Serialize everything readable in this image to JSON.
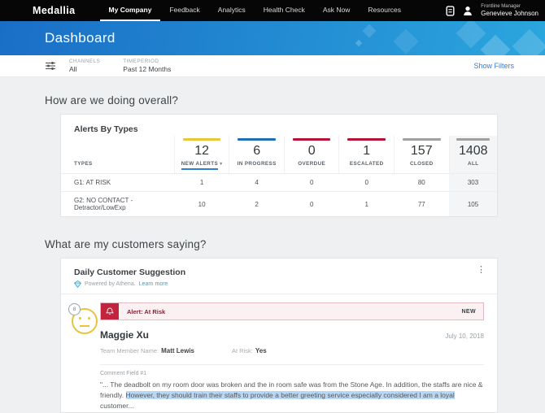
{
  "nav": {
    "brand": "Medallia",
    "items": [
      {
        "label": "My Company",
        "active": true
      },
      {
        "label": "Feedback",
        "active": false
      },
      {
        "label": "Analytics",
        "active": false
      },
      {
        "label": "Health Check",
        "active": false
      },
      {
        "label": "Ask Now",
        "active": false
      },
      {
        "label": "Resources",
        "active": false
      }
    ],
    "user_role": "Frontline Manager",
    "user_name": "Genevieve Johnson"
  },
  "header": {
    "title": "Dashboard"
  },
  "filter_bar": {
    "channels_label": "CHANNELS",
    "channels_value": "All",
    "timeperiod_label": "TIMEPERIOD",
    "timeperiod_value": "Past 12 Months",
    "show_filters_label": "Show Filters"
  },
  "overall_section": {
    "heading": "How are we doing overall?",
    "card_title": "Alerts By Types",
    "types_header": "TYPES",
    "stats": [
      {
        "label": "NEW ALERTS",
        "value": "12",
        "color": "#e9c63a",
        "sorted": true
      },
      {
        "label": "IN PROGRESS",
        "value": "6",
        "color": "#1e6fb4",
        "sorted": false
      },
      {
        "label": "OVERDUE",
        "value": "0",
        "color": "#b81238",
        "sorted": false
      },
      {
        "label": "ESCALATED",
        "value": "1",
        "color": "#b81238",
        "sorted": false
      },
      {
        "label": "CLOSED",
        "value": "157",
        "color": "#a0a0a0",
        "sorted": false
      },
      {
        "label": "ALL",
        "value": "1408",
        "color": "#a0a0a0",
        "sorted": false
      }
    ],
    "rows": [
      {
        "type": "G1: AT RISK",
        "values": [
          "1",
          "4",
          "0",
          "0",
          "80",
          "303"
        ]
      },
      {
        "type": "G2: NO CONTACT - Detractor/LowExp",
        "values": [
          "10",
          "2",
          "0",
          "1",
          "77",
          "105"
        ]
      }
    ]
  },
  "customers_section": {
    "heading": "What are my customers saying?",
    "card_title": "Daily Customer Suggestion",
    "powered_by": "Powered by Athena.",
    "learn_more": "Learn more",
    "score": "8",
    "alert_label": "Alert: At Risk",
    "new_badge": "NEW",
    "customer_name": "Maggie Xu",
    "date": "July 10, 2018",
    "team_member_label": "Team Member Name:",
    "team_member_value": "Matt Lewis",
    "at_risk_label": "At Risk:",
    "at_risk_value": "Yes",
    "comment_label": "Comment Field #1",
    "comment_pre": "\"... The deadbolt on my room door was broken and the in room safe was from the Stone Age.  In addition, the staffs are nice & friendly. ",
    "comment_highlight": "However, they should train their staffs to provide a better greeting service especially considered I am a loyal ",
    "comment_post": "customer..."
  },
  "icons": {
    "kebab": "⋮",
    "sort_caret": "▾",
    "names": [
      "document-icon",
      "user-icon",
      "filter-sliders-icon",
      "bell-icon",
      "athena-gem-icon",
      "neutral-face-icon",
      "kebab-icon",
      "sort-caret-icon"
    ]
  },
  "colors": {
    "accent_blue": "#2f80d6",
    "table_link_blue": "#4f93d8",
    "alert_red": "#c2243e",
    "banner_gradient_start": "#1a6ec6",
    "banner_gradient_end": "#2ba6de",
    "stat_yellow": "#e9c63a",
    "stat_blue": "#1e6fb4",
    "stat_red": "#b81238",
    "stat_gray": "#a0a0a0",
    "selection_highlight": "#b9d7f3",
    "emoji_yellow": "#e7c43b"
  }
}
